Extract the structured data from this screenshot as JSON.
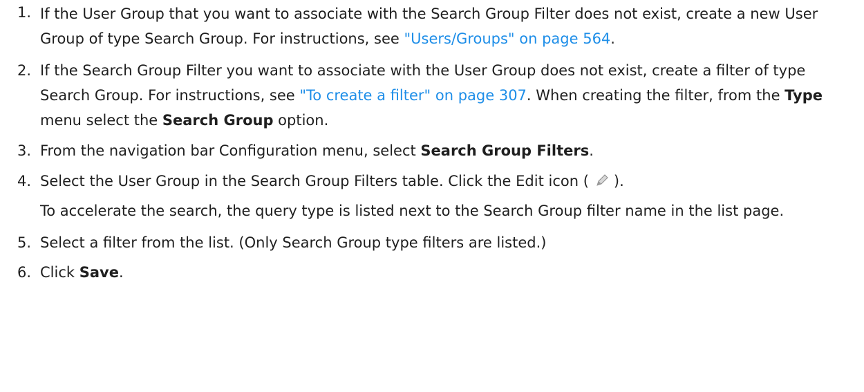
{
  "steps": [
    {
      "number": "1.",
      "text_a": "If the User Group that you want to associate with the Search Group Filter does not exist, create a new User Group of type Search Group. For instructions, see ",
      "link": "\"Users/Groups\" on page 564",
      "text_b": "."
    },
    {
      "number": "2.",
      "text_a": "If the Search Group Filter you want to associate with the User Group does not exist, create a filter of type Search Group. For instructions, see ",
      "link": "\"To create a filter\" on page 307",
      "text_b": ". When creating the filter, from the ",
      "bold_1": "Type",
      "text_c": " menu select the ",
      "bold_2": "Search Group",
      "text_d": " option."
    },
    {
      "number": "3.",
      "text_a": "From the navigation bar Configuration menu, select ",
      "bold_1": "Search Group Filters",
      "text_b": "."
    },
    {
      "number": "4.",
      "text_a": "Select the User Group in the Search Group Filters table. Click the Edit icon (",
      "icon": "pencil-icon",
      "text_b": ")."
    },
    {
      "number": "5.",
      "text_a": "Select a filter from the list. (Only Search Group type filters are listed.)"
    },
    {
      "number": "6.",
      "text_a": "Click ",
      "bold_1": "Save",
      "text_b": "."
    }
  ],
  "note": "To accelerate the search, the query type is listed next to the Search Group filter name in the list page.",
  "colors": {
    "text": "#1f1f1f",
    "link": "#1e8ee8"
  }
}
